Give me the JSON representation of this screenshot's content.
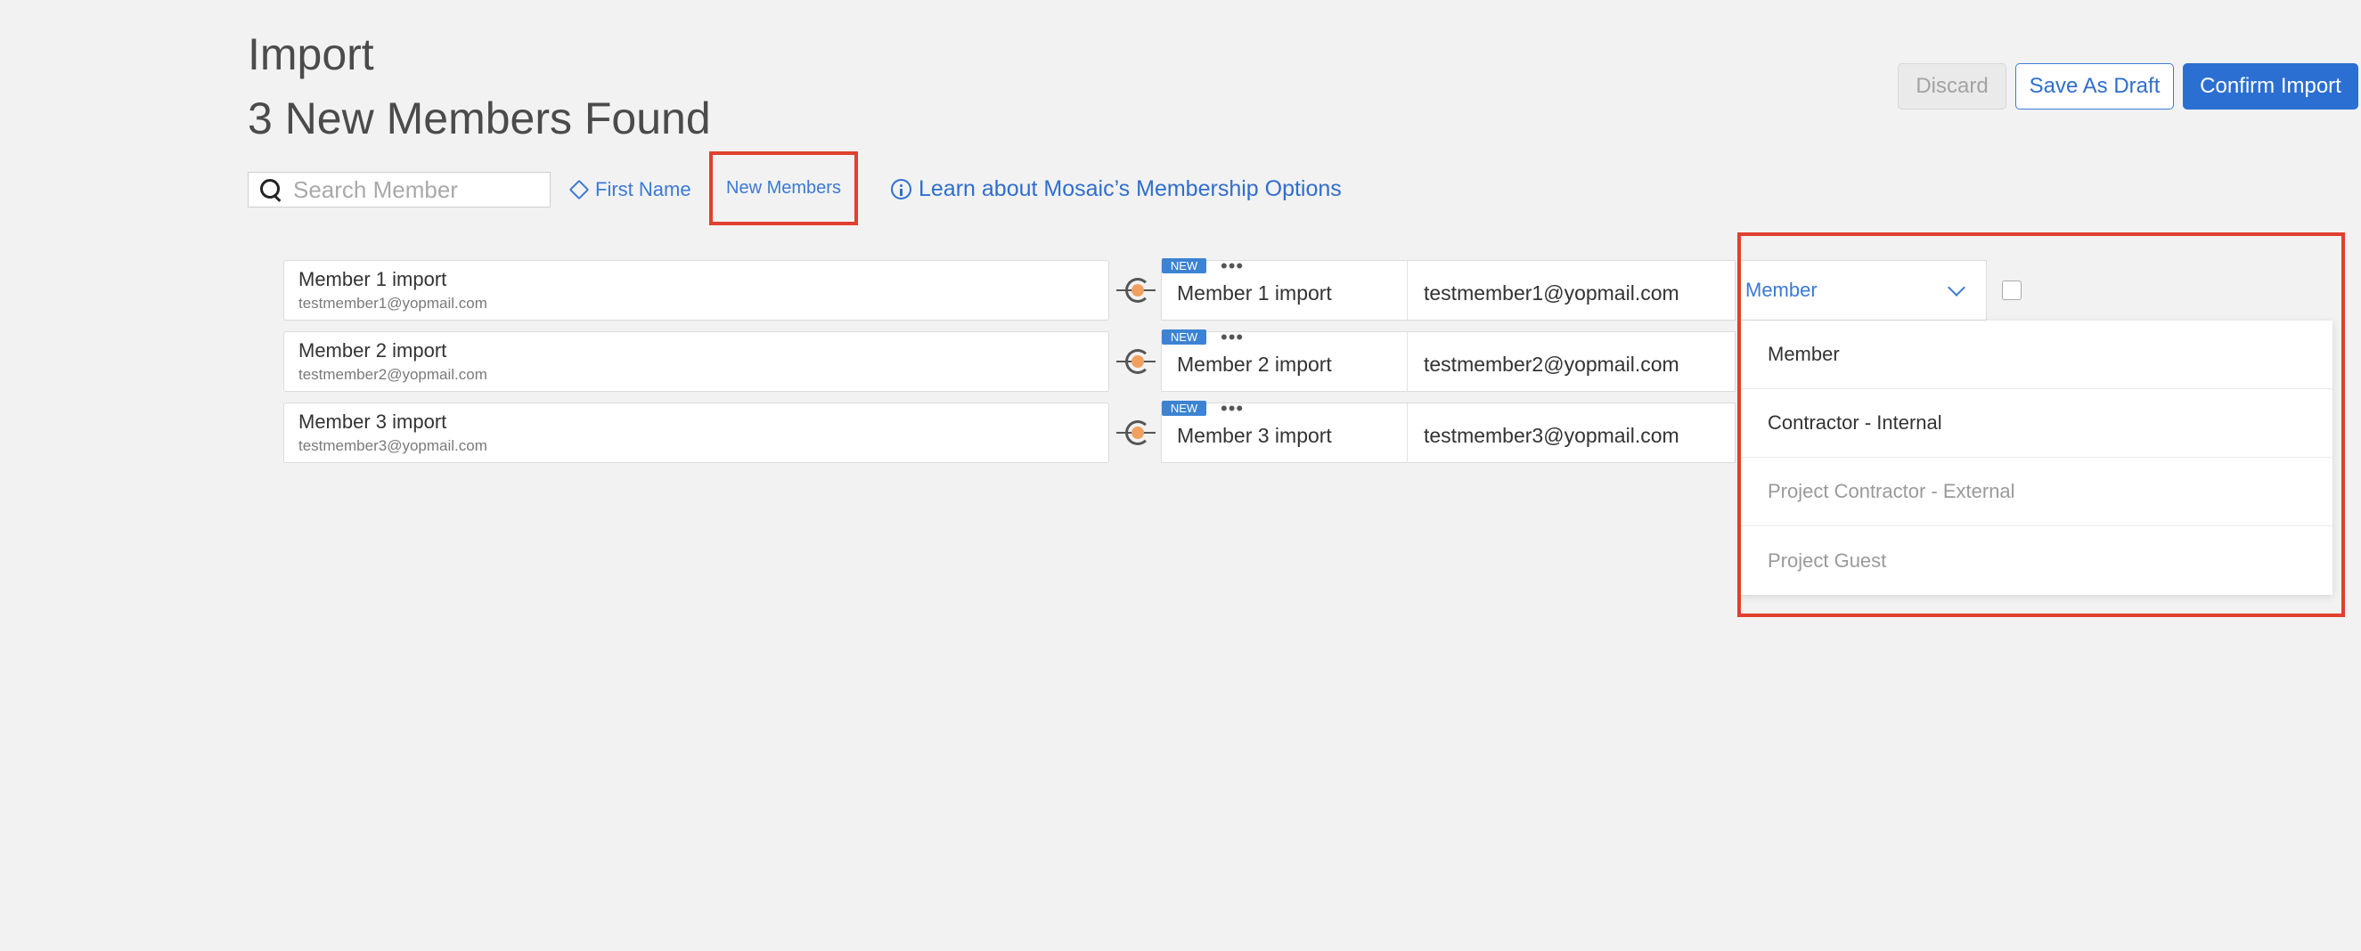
{
  "header": {
    "title": "Import",
    "subtitle": "3 New Members Found"
  },
  "actions": {
    "discard": "Discard",
    "save_draft": "Save As Draft",
    "confirm": "Confirm Import"
  },
  "toolbar": {
    "search_placeholder": "Search Member",
    "sort_label": "First Name",
    "filter_label": "New Members",
    "learn_link": "Learn about Mosaic’s Membership Options"
  },
  "rows": [
    {
      "left_name": "Member 1 import",
      "left_email": "testmember1@yopmail.com",
      "badge": "NEW",
      "name": "Member 1 import",
      "email": "testmember1@yopmail.com",
      "role": "Member"
    },
    {
      "left_name": "Member 2 import",
      "left_email": "testmember2@yopmail.com",
      "badge": "NEW",
      "name": "Member 2 import",
      "email": "testmember2@yopmail.com",
      "role": ""
    },
    {
      "left_name": "Member 3 import",
      "left_email": "testmember3@yopmail.com",
      "badge": "NEW",
      "name": "Member 3 import",
      "email": "testmember3@yopmail.com",
      "role": ""
    }
  ],
  "dropdown": {
    "options": [
      {
        "label": "Member",
        "enabled": true
      },
      {
        "label": "Contractor - Internal",
        "enabled": true
      },
      {
        "label": "Project Contractor - External",
        "enabled": false
      },
      {
        "label": "Project Guest",
        "enabled": false
      }
    ]
  },
  "colors": {
    "accent": "#2b6fd2",
    "highlight": "#e0402e",
    "badge": "#3c83d3",
    "connector_dot": "#f0a15f"
  }
}
